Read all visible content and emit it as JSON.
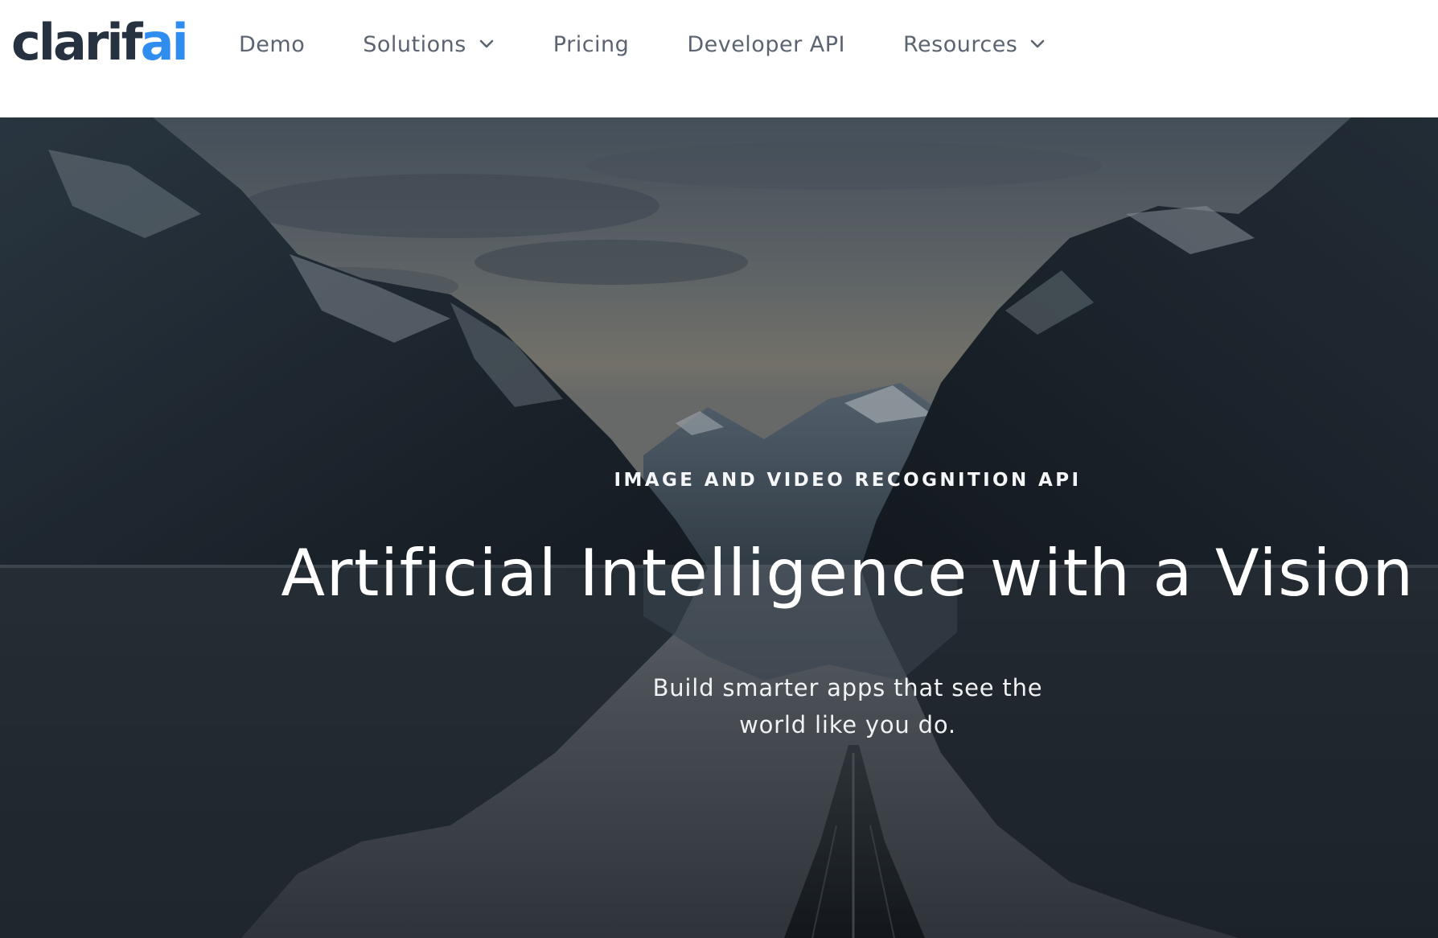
{
  "logo": {
    "part_dark": "clarif",
    "part_blue": "ai",
    "colors": {
      "dark": "#26323f",
      "blue": "#2f8df0"
    }
  },
  "nav": {
    "items": [
      {
        "label": "Demo",
        "has_dropdown": false
      },
      {
        "label": "Solutions",
        "has_dropdown": true,
        "icon": "chevron-down-icon"
      },
      {
        "label": "Pricing",
        "has_dropdown": false
      },
      {
        "label": "Developer API",
        "has_dropdown": false
      },
      {
        "label": "Resources",
        "has_dropdown": true,
        "icon": "chevron-down-icon"
      }
    ],
    "text_color": "#5b6470"
  },
  "hero": {
    "eyebrow": "IMAGE AND VIDEO RECOGNITION API",
    "headline": "Artificial Intelligence with a Vision",
    "subline": "Build smarter apps that see the world like you do.",
    "text_color": "#ffffff"
  }
}
